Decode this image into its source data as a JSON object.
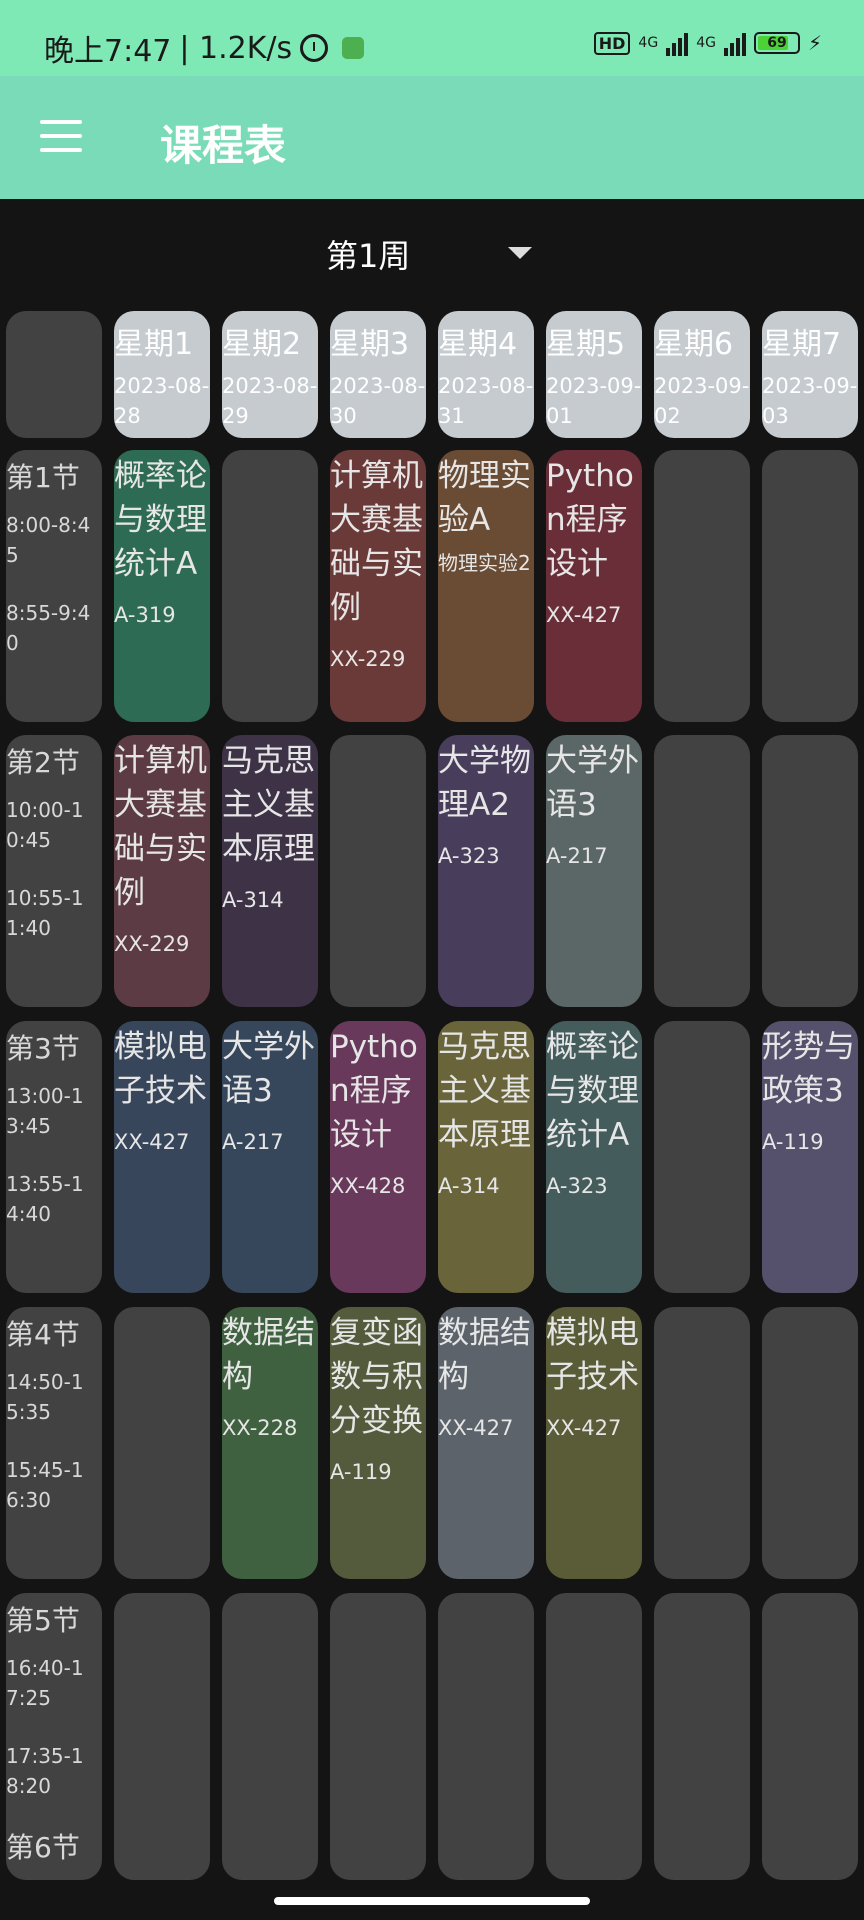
{
  "status_bar": {
    "time": "晚上7:47",
    "net_speed": "| 1.2K/s",
    "hd": "HD",
    "net1": "4G",
    "net2": "4G",
    "battery": "69"
  },
  "app_bar": {
    "title": "课程表"
  },
  "week_selector": {
    "label": "第1周"
  },
  "days": [
    {
      "name": "星期1",
      "date": "2023-08-28"
    },
    {
      "name": "星期2",
      "date": "2023-08-29"
    },
    {
      "name": "星期3",
      "date": "2023-08-30"
    },
    {
      "name": "星期4",
      "date": "2023-08-31"
    },
    {
      "name": "星期5",
      "date": "2023-09-01"
    },
    {
      "name": "星期6",
      "date": "2023-09-02"
    },
    {
      "name": "星期7",
      "date": "2023-09-03"
    }
  ],
  "periods": [
    {
      "name": "第1节",
      "t1": "8:00-8:45",
      "t2": "8:55-9:40"
    },
    {
      "name": "第2节",
      "t1": "10:00-10:45",
      "t2": "10:55-11:40"
    },
    {
      "name": "第3节",
      "t1": "13:00-13:45",
      "t2": "13:55-14:40"
    },
    {
      "name": "第4节",
      "t1": "14:50-15:35",
      "t2": "15:45-16:30"
    },
    {
      "name": "第5节",
      "t1": "16:40-17:25",
      "t2": "17:35-18:20"
    },
    {
      "name": "第6节",
      "t1": "",
      "t2": ""
    }
  ],
  "courses": [
    {
      "period": 0,
      "day": 0,
      "name": "概率论与数理统计A",
      "room": "A-319",
      "color": "#2e6b55"
    },
    {
      "period": 0,
      "day": 2,
      "name": "计算机大赛基础与实例",
      "room": "XX-229",
      "color": "#6a3a38"
    },
    {
      "period": 0,
      "day": 3,
      "name": "物理实验A",
      "sub": "物理实验2",
      "room": "",
      "color": "#6a4b33"
    },
    {
      "period": 0,
      "day": 4,
      "name": "Python程序设计",
      "room": "XX-427",
      "color": "#6a2e38"
    },
    {
      "period": 1,
      "day": 0,
      "name": "计算机大赛基础与实例",
      "room": "XX-229",
      "color": "#5c3b44"
    },
    {
      "period": 1,
      "day": 1,
      "name": "马克思主义基本原理",
      "room": "A-314",
      "color": "#3d3246"
    },
    {
      "period": 1,
      "day": 3,
      "name": "大学物理A2",
      "room": "A-323",
      "color": "#483e5c"
    },
    {
      "period": 1,
      "day": 4,
      "name": "大学外语3",
      "room": "A-217",
      "color": "#5b6766"
    },
    {
      "period": 2,
      "day": 0,
      "name": "模拟电子技术",
      "room": "XX-427",
      "color": "#37465a"
    },
    {
      "period": 2,
      "day": 1,
      "name": "大学外语3",
      "room": "A-217",
      "color": "#36475c"
    },
    {
      "period": 2,
      "day": 2,
      "name": "Python程序设计",
      "room": "XX-428",
      "color": "#69395c"
    },
    {
      "period": 2,
      "day": 3,
      "name": "马克思主义基本原理",
      "room": "A-314",
      "color": "#69643a"
    },
    {
      "period": 2,
      "day": 4,
      "name": "概率论与数理统计A",
      "room": "A-323",
      "color": "#455c5c"
    },
    {
      "period": 2,
      "day": 6,
      "name": "形势与政策3",
      "room": "A-119",
      "color": "#55506b"
    },
    {
      "period": 3,
      "day": 1,
      "name": "数据结构",
      "room": "XX-228",
      "color": "#3f6140"
    },
    {
      "period": 3,
      "day": 2,
      "name": "复变函数与积分变换",
      "room": "A-119",
      "color": "#535b3c"
    },
    {
      "period": 3,
      "day": 3,
      "name": "数据结构",
      "room": "XX-427",
      "color": "#5c636b"
    },
    {
      "period": 3,
      "day": 4,
      "name": "模拟电子技术",
      "room": "XX-427",
      "color": "#5a5b37"
    }
  ]
}
